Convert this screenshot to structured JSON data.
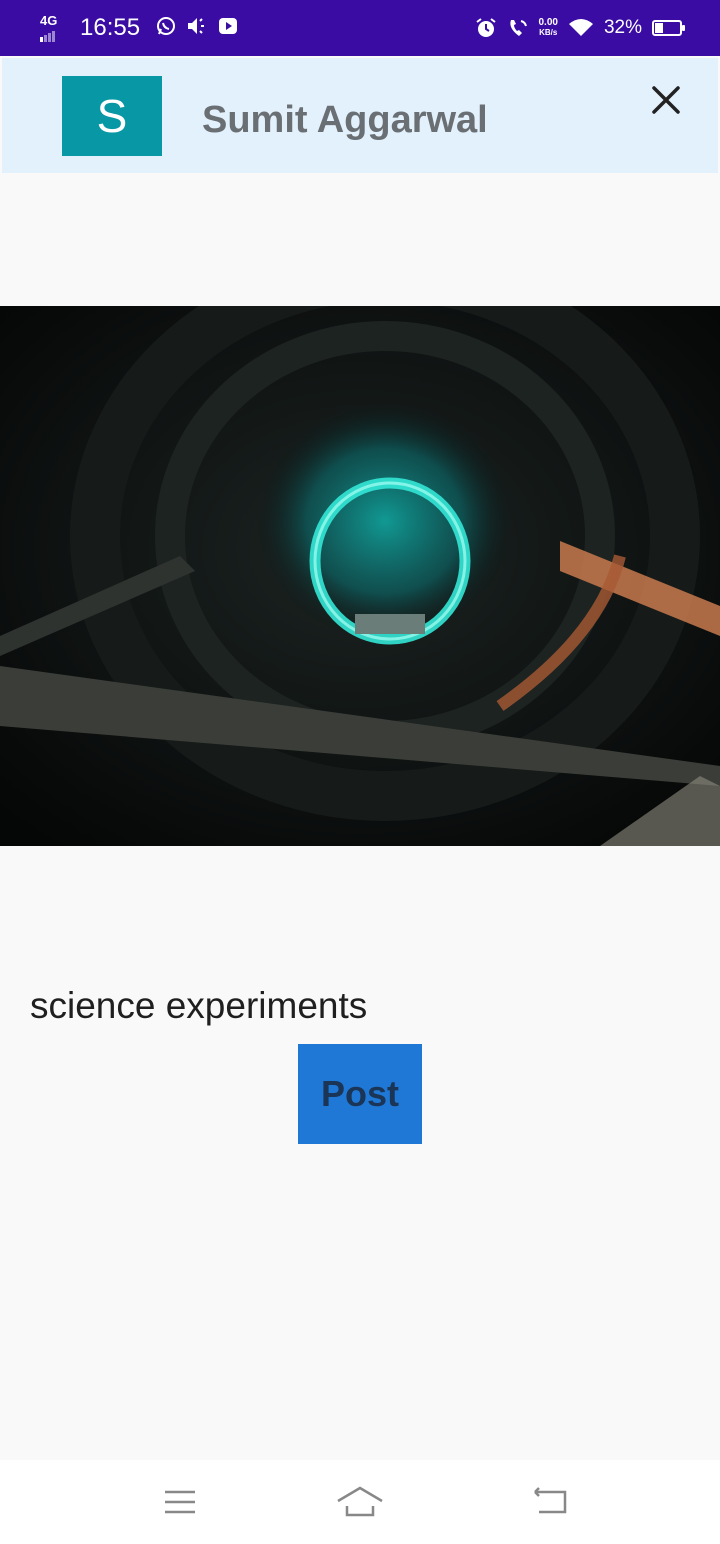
{
  "status_bar": {
    "network": "4G",
    "time": "16:55",
    "speed_value": "0.00",
    "speed_unit": "KB/s",
    "battery_percent": "32%",
    "battery_level": 0.32,
    "icons": [
      "whatsapp-icon",
      "mute-icon",
      "youtube-icon",
      "alarm-icon",
      "wifi-calling-icon",
      "wifi-icon",
      "battery-icon"
    ]
  },
  "header": {
    "avatar_letter": "S",
    "avatar_color": "#0897a5",
    "user_name": "Sumit Aggarwal",
    "close_icon": "close-icon"
  },
  "post": {
    "image_icon": "photo-image",
    "caption": "science experiments",
    "button_label": "Post",
    "button_color": "#1f78d6"
  },
  "nav_bar": {
    "icons": [
      "menu-icon",
      "home-icon",
      "back-icon"
    ]
  }
}
